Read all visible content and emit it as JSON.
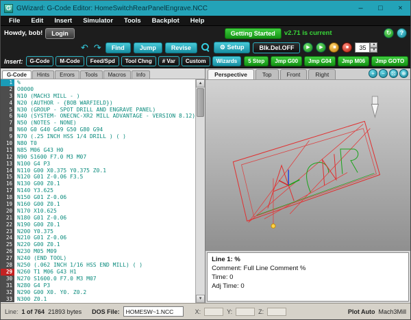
{
  "window": {
    "title": "GWizard: G-Code Editor: HomeSwitchRearPanelEngrave.NCC"
  },
  "icons": {
    "minimize": "–",
    "maximize": "□",
    "close": "×",
    "undo": "↶",
    "redo": "↷",
    "sync": "↻",
    "help": "?",
    "gear": "⚙",
    "play": "▶",
    "play_to": "▶",
    "pause": "▮▮",
    "stop": "■",
    "spin_up": "▲",
    "spin_down": "▼",
    "scroll_up": "▲",
    "scroll_down": "▼",
    "zoom_in": "+",
    "zoom_out": "−",
    "zoom_window": "⊡",
    "zoom_extents": "⊕"
  },
  "menu": {
    "items": [
      "File",
      "Edit",
      "Insert",
      "Simulator",
      "Tools",
      "Backplot",
      "Help"
    ]
  },
  "toolbar": {
    "greeting": "Howdy, bob!",
    "login_label": "Login",
    "getting_started_label": "Getting Started",
    "version_text": "v2.71 is current",
    "find_label": "Find",
    "jump_label": "Jump",
    "revise_label": "Revise",
    "setup_label": "Setup",
    "blk_del_label": "Blk.Del.OFF",
    "speed_value": "35",
    "insert_label": "Insert:",
    "insert_buttons": [
      "G-Code",
      "M-Code",
      "Feed/Spd",
      "Tool Chng",
      "# Var",
      "Custom",
      "Wizards"
    ],
    "step_buttons": [
      "5 Step",
      "Jmp G00",
      "Jmp G04",
      "Jmp M06",
      "Jmp GOTO"
    ]
  },
  "editor": {
    "tabs": [
      "G-Code",
      "Hints",
      "Errors",
      "Tools",
      "Macros",
      "Info"
    ],
    "active_tab": "G-Code",
    "current_line": 1,
    "error_line": 29,
    "lines": [
      "%",
      "O0000",
      "N10 (MACH3 MILL - )",
      "N20 (AUTHOR - {BOB WARFIELD})",
      "N30 (GROUP - SPOT DRILL AND ENGRAVE PANEL)",
      "N40 (SYSTEM- ONECNC-XR2 MILL ADVANTAGE - VERSION 8.12)",
      "N50 (NOTES - NONE)",
      "N60 G0 G40 G49 G50 G80 G94",
      "N70 (.25 INCH HSS 1/4 DRILL ) ( )",
      "N80 T0",
      "N85 M06 G43 H0",
      "N90 S1600 F7.0 M3 M07",
      "N100 G4 P3",
      "N110 G00 X0.375 Y0.375 Z0.1",
      "N120 G01 Z-0.06 F3.5",
      "N130 G00 Z0.1",
      "N140 Y3.625",
      "N150 G01 Z-0.06",
      "N160 G00 Z0.1",
      "N170 X10.625",
      "N180 G01 Z-0.06",
      "N190 G00 Z0.1",
      "N200 Y0.375",
      "N210 G01 Z-0.06",
      "N220 G00 Z0.1",
      "N230 M05 M09",
      "N240 (END TOOL)",
      "N250 (.062 INCH 1/16 HSS END MILL) ( )",
      "N260 T1 M06 G43 H1",
      "N270 S1600.0 F7.0 M3 M07",
      "N280 G4 P3",
      "N290 G00 X0. Y0. Z0.2",
      "N300 Z0.1"
    ]
  },
  "viewport": {
    "tabs": [
      "Perspective",
      "Top",
      "Front",
      "Right"
    ],
    "active_tab": "Perspective"
  },
  "details": {
    "line": "Line 1: %",
    "comment": "Comment: Full Line Comment %",
    "time": "Time: 0",
    "adj_time": "Adj Time: 0"
  },
  "status": {
    "line_label": "Line:",
    "line_value": "1 of 764",
    "bytes_value": "21893 bytes",
    "dos_file_label": "DOS File:",
    "dos_file_value": "HOMESW~1.NCC",
    "x_label": "X:",
    "y_label": "Y:",
    "z_label": "Z:",
    "plot_text": "Plot Auto",
    "machine_name": "Mach3Mill"
  },
  "colors": {
    "titlebar": "#23a3b8",
    "accent_teal": "#2bb3c4",
    "accent_green": "#2eb82e",
    "code_text": "#0a8b7d",
    "error_red": "#c32222",
    "version_green": "#39d839"
  }
}
